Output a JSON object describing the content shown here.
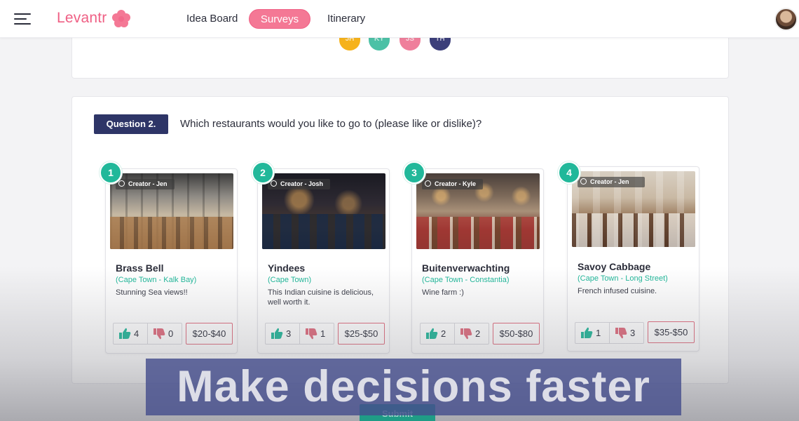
{
  "app": {
    "name": "Levantr",
    "brand_color": "#ef5f84",
    "accent_teal": "#21b89a",
    "question_badge_color": "#2e3567"
  },
  "nav": {
    "menu_icon": "hamburger-menu-icon",
    "tabs": [
      {
        "label": "Idea Board",
        "active": false
      },
      {
        "label": "Surveys",
        "active": true
      },
      {
        "label": "Itinerary",
        "active": false
      }
    ]
  },
  "previous_card": {
    "participants": [
      {
        "initials": "JH",
        "color": "#f6b21a"
      },
      {
        "initials": "KY",
        "color": "#4cc1a6"
      },
      {
        "initials": "JS",
        "color": "#ef7f9b"
      },
      {
        "initials": "TH",
        "color": "#3c3f7a"
      }
    ]
  },
  "question": {
    "badge": "Question 2.",
    "text": "Which restaurants would you like to go to (please like or dislike)?"
  },
  "restaurants": [
    {
      "number": "1",
      "creator": "Creator - Jen",
      "name": "Brass Bell",
      "location": "(Cape Town - Kalk Bay)",
      "description": "Stunning Sea views!!",
      "likes": "4",
      "dislikes": "0",
      "price": "$20-$40"
    },
    {
      "number": "2",
      "creator": "Creator - Josh",
      "name": "Yindees",
      "location": "(Cape Town)",
      "description": "This Indian cuisine is delicious, well worth it.",
      "likes": "3",
      "dislikes": "1",
      "price": "$25-$50"
    },
    {
      "number": "3",
      "creator": "Creator - Kyle",
      "name": "Buitenverwachting",
      "location": "(Cape Town - Constantia)",
      "description": "Wine farm :)",
      "likes": "2",
      "dislikes": "2",
      "price": "$50-$80"
    },
    {
      "number": "4",
      "creator": "Creator - Jen",
      "name": "Savoy Cabbage",
      "location": "(Cape Town - Long Street)",
      "description": "French infused cuisine.",
      "likes": "1",
      "dislikes": "3",
      "price": "$35-$50"
    }
  ],
  "submit_label": "Submit",
  "banner_text": "Make decisions faster"
}
